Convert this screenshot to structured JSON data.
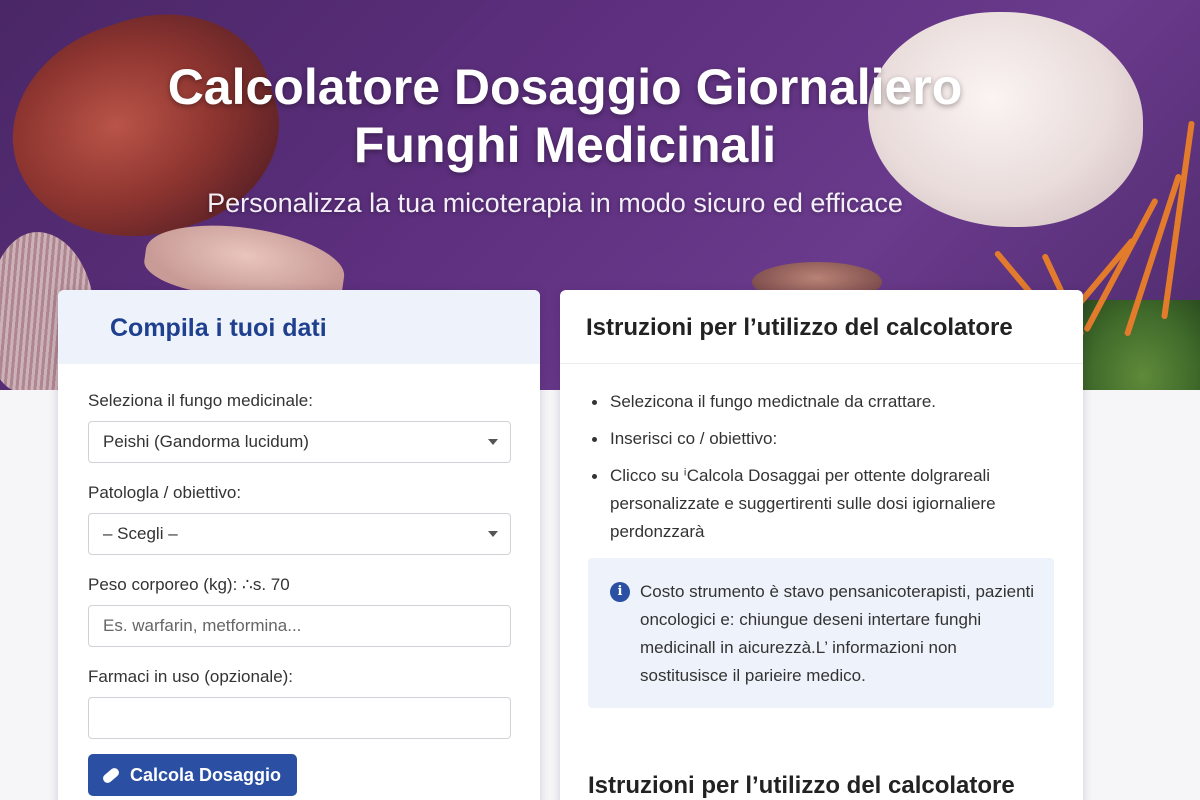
{
  "header": {
    "title_line1": "Calcolatore Dosaggio Giornaliero",
    "title_line2": "Funghi Medicinali",
    "subtitle": "Personalizza la tua micoterapia in modo sicuro ed efficace"
  },
  "form_card": {
    "title": "Compila i tuoi dati",
    "mushroom_label": "Seleziona il fungo medicinale:",
    "mushroom_value": "Peishi (Gandorma lucidum)",
    "pathology_label": "Patologla / obiettivo:",
    "pathology_value": "– Scegli –",
    "weight_label": "Peso corporeo (kg): ∴s. 70",
    "weight_placeholder": "Es. warfarin, metformina...",
    "drugs_label": "Farmaci in uso (opzionale):",
    "drugs_placeholder": "",
    "button_label": "Calcola Dosaggio"
  },
  "instructions_card": {
    "title": "Istruzioni per l’utilizzo del calcolatore",
    "items": [
      "Selezicona il fungo medictnale da crrattare.",
      "Inserisci co / obiettivo:",
      "Clicco su ⁱCalcola Dosaggai per ottente dolgrareali personalizzate e suggertirenti sulle dosi igiornaliere perdonzzarà"
    ],
    "info_text": "Costo strumento è stavo pensanicoterapisti, pazienti oncologici e: chiungue deseni intertare funghi medicinall in aicurezzà.L’ informazioni non sostitusisce il parieire medico.",
    "info_icon": "info-icon",
    "second_title": "Istruzioni per l’utilizzo del calcolatore"
  },
  "colors": {
    "hero": "#5d2f7e",
    "accent": "#2a4fa3",
    "form_title": "#1f3f8f",
    "panel_bg": "#eef3fb"
  }
}
